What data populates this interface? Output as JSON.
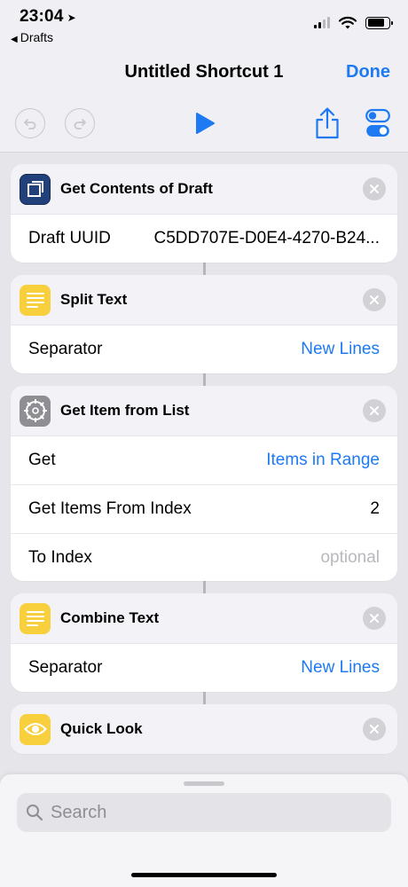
{
  "status": {
    "time": "23:04",
    "back_app": "Drafts"
  },
  "nav": {
    "title": "Untitled Shortcut 1",
    "done_label": "Done"
  },
  "colors": {
    "accent": "#1d7af3",
    "drafts_blue": "#22407a",
    "text_yellow": "#f8cf3d",
    "settings_grey": "#8e8e93"
  },
  "actions": [
    {
      "title": "Get Contents of Draft",
      "icon": "drafts-icon",
      "rows": [
        {
          "label": "Draft UUID",
          "value": "C5DD707E-D0E4-4270-B24..."
        }
      ]
    },
    {
      "title": "Split Text",
      "icon": "text-icon",
      "rows": [
        {
          "label": "Separator",
          "value": "New Lines"
        }
      ]
    },
    {
      "title": "Get Item from List",
      "icon": "gear-icon",
      "rows": [
        {
          "label": "Get",
          "value": "Items in Range"
        },
        {
          "label": "Get Items From Index",
          "value": "2"
        },
        {
          "label": "To Index",
          "value": "optional"
        }
      ]
    },
    {
      "title": "Combine Text",
      "icon": "text-icon",
      "rows": [
        {
          "label": "Separator",
          "value": "New Lines"
        }
      ]
    },
    {
      "title": "Quick Look",
      "icon": "eye-icon",
      "rows": []
    }
  ],
  "search": {
    "placeholder": "Search"
  }
}
